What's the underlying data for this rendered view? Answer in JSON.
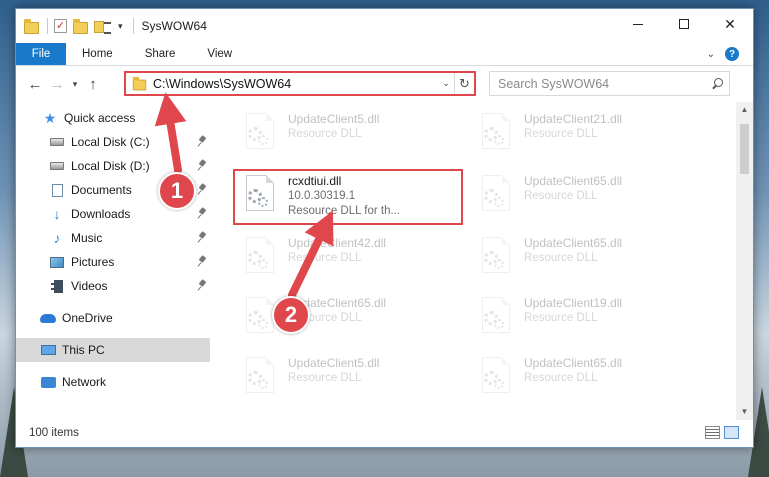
{
  "window": {
    "title": "SysWOW64",
    "minimize_icon": "minimize-icon",
    "maximize_icon": "maximize-icon",
    "close_glyph": "✕"
  },
  "ribbon": {
    "tabs": [
      {
        "label": "File"
      },
      {
        "label": "Home"
      },
      {
        "label": "Share"
      },
      {
        "label": "View"
      }
    ],
    "help_label": "?"
  },
  "address": {
    "path": "C:\\Windows\\SysWOW64",
    "search_placeholder": "Search SysWOW64"
  },
  "nav_pane": {
    "items": [
      {
        "label": "Quick access",
        "icon": "star-icon",
        "pinned": false
      },
      {
        "label": "Local Disk (C:)",
        "icon": "drive-icon",
        "pinned": true
      },
      {
        "label": "Local Disk (D:)",
        "icon": "drive-icon",
        "pinned": true
      },
      {
        "label": "Documents",
        "icon": "documents-icon",
        "pinned": true
      },
      {
        "label": "Downloads",
        "icon": "downloads-icon",
        "pinned": true
      },
      {
        "label": "Music",
        "icon": "music-icon",
        "pinned": true
      },
      {
        "label": "Pictures",
        "icon": "pictures-icon",
        "pinned": true
      },
      {
        "label": "Videos",
        "icon": "videos-icon",
        "pinned": true
      },
      {
        "label": "OneDrive",
        "icon": "onedrive-icon",
        "pinned": false
      },
      {
        "label": "This PC",
        "icon": "this-pc-icon",
        "pinned": false,
        "selected": true
      },
      {
        "label": "Network",
        "icon": "network-icon",
        "pinned": false
      }
    ]
  },
  "files": {
    "left_column": [
      {
        "name": "UpdateClient5.dll",
        "type": "Resource DLL",
        "faded": true
      },
      {
        "name": "rcxdtiui.dll",
        "version": "10.0.30319.1",
        "type": "Resource DLL for th...",
        "faded": false,
        "highlighted": true
      },
      {
        "name": "UpdateClient42.dll",
        "type": "Resource DLL",
        "faded": true
      },
      {
        "name": "UpdateClient65.dll",
        "type": "Resource DLL",
        "faded": true
      },
      {
        "name": "UpdateClient5.dll",
        "type": "Resource DLL",
        "faded": true
      }
    ],
    "right_column": [
      {
        "name": "UpdateClient21.dll",
        "type": "Resource DLL",
        "faded": true
      },
      {
        "name": "UpdateClient65.dll",
        "type": "Resource DLL",
        "faded": true
      },
      {
        "name": "UpdateClient65.dll",
        "type": "Resource DLL",
        "faded": true
      },
      {
        "name": "UpdateClient19.dll",
        "type": "Resource DLL",
        "faded": true
      },
      {
        "name": "UpdateClient65.dll",
        "type": "Resource DLL",
        "faded": true
      }
    ]
  },
  "status": {
    "item_count": "100 items"
  },
  "annotations": {
    "step1": "1",
    "step2": "2",
    "color": "#e0474c"
  },
  "colors": {
    "accent": "#1979ca",
    "annotation_red": "#e0474c"
  }
}
